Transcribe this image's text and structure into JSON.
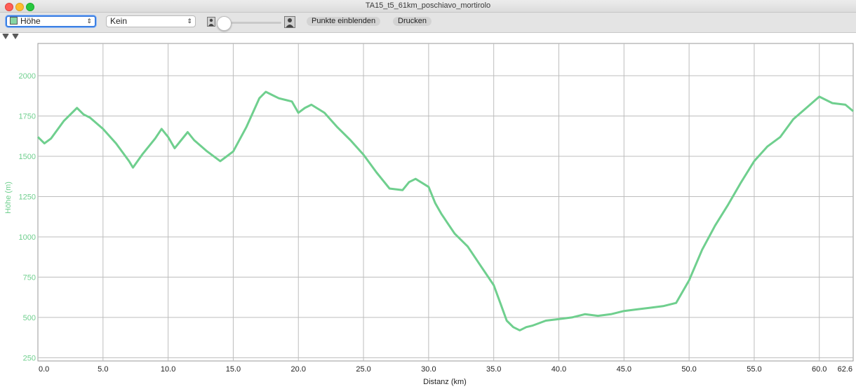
{
  "window": {
    "title": "TA15_t5_61km_poschiavo_mortirolo"
  },
  "toolbar": {
    "metric_select": "Höhe",
    "overlay_select": "Kein",
    "points_button": "Punkte einblenden",
    "print_button": "Drucken"
  },
  "colors": {
    "line": "#6fcf8e",
    "axis_text": "#6fcf8e",
    "grid": "#bdbdbd"
  },
  "chart_data": {
    "type": "line",
    "title": "",
    "xlabel": "Distanz (km)",
    "ylabel": "Höhe (m)",
    "xlim": [
      0,
      62.6
    ],
    "ylim": [
      230,
      2200
    ],
    "x_ticks": [
      "0.0",
      "5.0",
      "10.0",
      "15.0",
      "20.0",
      "25.0",
      "30.0",
      "35.0",
      "40.0",
      "45.0",
      "50.0",
      "55.0",
      "60.0",
      "62.6"
    ],
    "y_ticks": [
      "250",
      "500",
      "750",
      "1000",
      "1250",
      "1500",
      "1750",
      "2000"
    ],
    "grid": true,
    "series": [
      {
        "x": [
          0,
          0.5,
          1,
          2,
          3,
          3.5,
          4,
          5,
          6,
          7,
          7.3,
          8,
          9,
          9.5,
          10,
          10.5,
          11,
          11.5,
          12,
          13,
          14,
          14.5,
          15,
          16,
          17,
          17.5,
          18,
          18.5,
          19,
          19.5,
          20,
          20.5,
          21,
          22,
          23,
          24,
          25,
          26,
          27,
          28,
          28.5,
          29,
          30,
          30.5,
          31,
          32,
          33,
          34,
          35,
          35.5,
          36,
          36.5,
          37,
          37.5,
          38,
          39,
          40,
          41,
          42,
          43,
          44,
          45,
          46,
          47,
          48,
          49,
          50,
          51,
          52,
          53,
          54,
          55,
          56,
          57,
          58,
          59,
          60,
          61,
          62,
          62.6
        ],
        "y": [
          1620,
          1580,
          1610,
          1720,
          1800,
          1760,
          1740,
          1670,
          1580,
          1470,
          1430,
          1510,
          1610,
          1670,
          1620,
          1550,
          1600,
          1650,
          1600,
          1530,
          1470,
          1500,
          1530,
          1680,
          1860,
          1900,
          1880,
          1860,
          1850,
          1840,
          1770,
          1800,
          1820,
          1770,
          1680,
          1600,
          1510,
          1400,
          1300,
          1290,
          1340,
          1360,
          1310,
          1210,
          1140,
          1020,
          940,
          820,
          700,
          590,
          480,
          440,
          420,
          440,
          450,
          480,
          490,
          500,
          520,
          510,
          520,
          540,
          550,
          560,
          570,
          590,
          730,
          920,
          1070,
          1200,
          1340,
          1470,
          1560,
          1620,
          1730,
          1800,
          1870,
          1830,
          1820,
          1780
        ]
      }
    ]
  }
}
